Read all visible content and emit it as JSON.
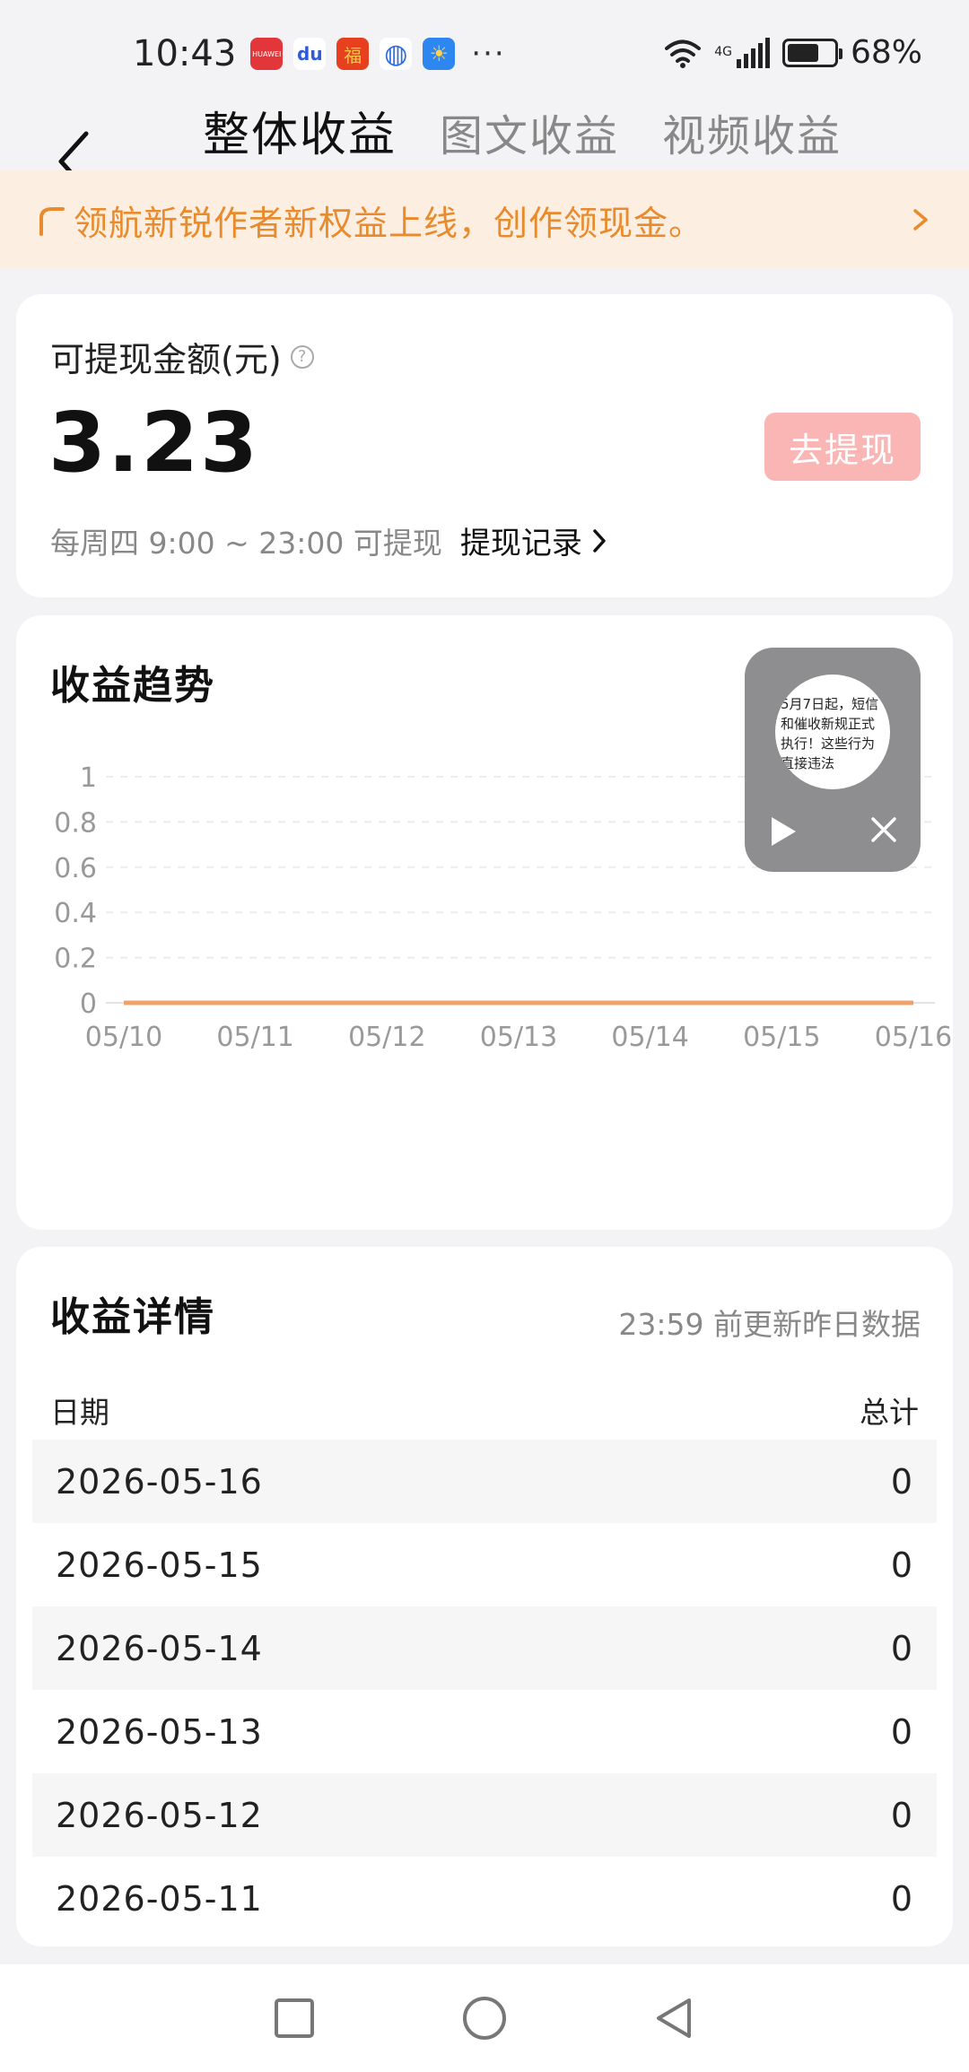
{
  "status_bar": {
    "time": "10:43",
    "battery": "68%",
    "battery_level": 0.68,
    "network": "4G",
    "more": "···",
    "apps": [
      {
        "icon": "huawei-appgallery-icon",
        "glyph": "HUAWEI"
      },
      {
        "icon": "baidu-icon",
        "glyph": "du"
      },
      {
        "icon": "red-packet-icon",
        "glyph": "福"
      },
      {
        "icon": "globe-icon",
        "glyph": "◍"
      },
      {
        "icon": "weather-icon",
        "glyph": "☀"
      }
    ]
  },
  "header": {
    "tabs": [
      {
        "label": "整体收益",
        "active": true
      },
      {
        "label": "图文收益",
        "active": false
      },
      {
        "label": "视频收益",
        "active": false
      }
    ]
  },
  "banner": {
    "text": "领航新锐作者新权益上线，创作领现金。",
    "color": "#e98a2c"
  },
  "withdraw": {
    "label": "可提现金额(元)",
    "help": "?",
    "amount": "3.23",
    "button_label": "去提现",
    "hint": "每周四 9:00 ~ 23:00 可提现",
    "record_label": "提现记录"
  },
  "trend": {
    "title": "收益趋势",
    "float_video": {
      "caption_lines": [
        "5月7日起，短信",
        "和催收新规正式",
        "执行！这些行为",
        "直接违法"
      ]
    }
  },
  "chart_data": {
    "type": "line",
    "title": "收益趋势",
    "xlabel": "",
    "ylabel": "",
    "x": [
      "05/10",
      "05/11",
      "05/12",
      "05/13",
      "05/14",
      "05/15",
      "05/16"
    ],
    "y_ticks": [
      "0",
      "0.2",
      "0.4",
      "0.6",
      "0.8",
      "1"
    ],
    "ylim": [
      0,
      1
    ],
    "grid": true,
    "series": [
      {
        "values": [
          0,
          0,
          0,
          0,
          0,
          0,
          0
        ],
        "color": "#f0a069"
      }
    ]
  },
  "details": {
    "title": "收益详情",
    "note": "23:59 前更新昨日数据",
    "columns": [
      "日期",
      "总计"
    ],
    "rows": [
      {
        "date": "2026-05-16",
        "total": "0"
      },
      {
        "date": "2026-05-15",
        "total": "0"
      },
      {
        "date": "2026-05-14",
        "total": "0"
      },
      {
        "date": "2026-05-13",
        "total": "0"
      },
      {
        "date": "2026-05-12",
        "total": "0"
      },
      {
        "date": "2026-05-11",
        "total": "0"
      }
    ]
  }
}
